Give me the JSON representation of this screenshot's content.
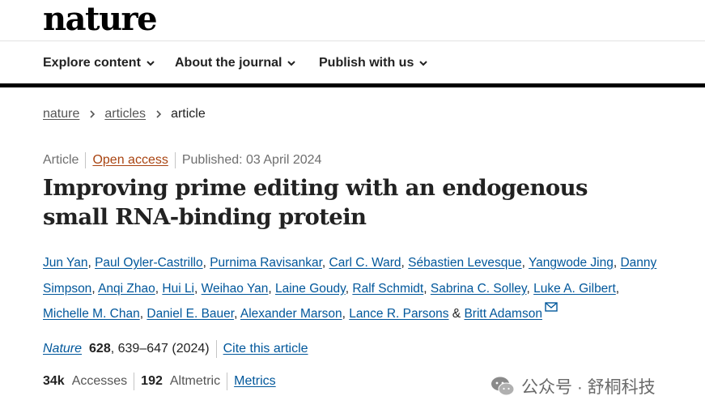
{
  "header": {
    "logo": "nature"
  },
  "nav": {
    "items": [
      {
        "label": "Explore content"
      },
      {
        "label": "About the journal"
      },
      {
        "label": "Publish with us"
      }
    ]
  },
  "breadcrumb": {
    "items": [
      "nature",
      "articles",
      "article"
    ]
  },
  "meta": {
    "type": "Article",
    "access": "Open access",
    "published": "Published: 03 April 2024"
  },
  "article": {
    "title": "Improving prime editing with an endogenous small RNA-binding protein"
  },
  "authors": [
    "Jun Yan",
    "Paul Oyler-Castrillo",
    "Purnima Ravisankar",
    "Carl C. Ward",
    "Sébastien Levesque",
    "Yangwode Jing",
    "Danny Simpson",
    "Anqi Zhao",
    "Hui Li",
    "Weihao Yan",
    "Laine Goudy",
    "Ralf Schmidt",
    "Sabrina C. Solley",
    "Luke A. Gilbert",
    "Michelle M. Chan",
    "Daniel E. Bauer",
    "Alexander Marson",
    "Lance R. Parsons",
    "Britt Adamson"
  ],
  "authors_separators": {
    "comma": ", ",
    "last": " & "
  },
  "citation": {
    "journal": "Nature",
    "volume": "628",
    "pages": ", 639–647 (2024)",
    "cite_label": "Cite this article"
  },
  "metrics": {
    "accesses_value": "34k",
    "accesses_label": "Accesses",
    "altmetric_value": "192",
    "altmetric_label": "Altmetric",
    "metrics_link": "Metrics"
  },
  "watermark": {
    "text": "公众号 · 舒桐科技"
  },
  "colors": {
    "link": "#01579b",
    "open_access": "#a94411",
    "text": "#222222",
    "muted": "#6f6f6f"
  },
  "icons": [
    "chevron-down-icon",
    "chevron-right-icon",
    "mail-icon",
    "wechat-icon"
  ]
}
